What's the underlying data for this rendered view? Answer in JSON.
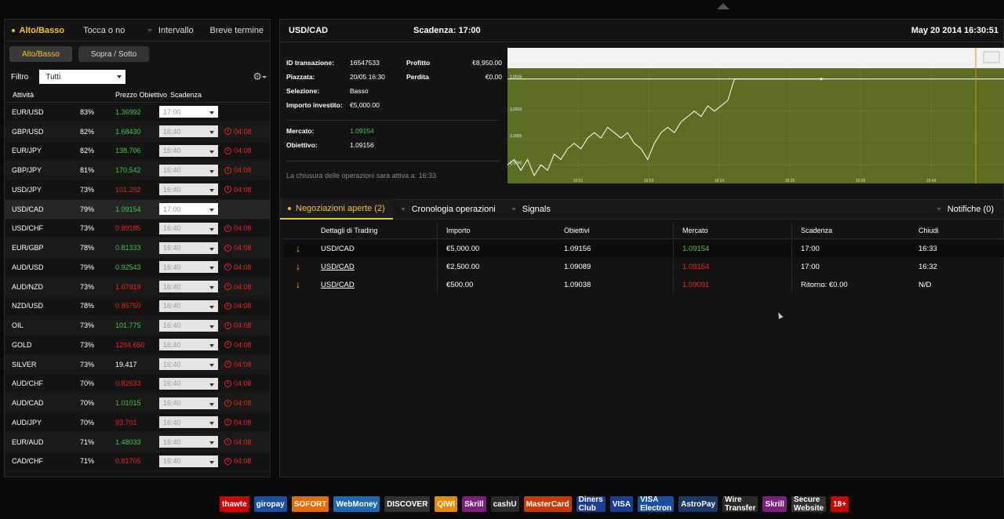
{
  "left": {
    "tabs": [
      "Alto/Basso",
      "Tocca o no",
      "Intervallo",
      "Breve termine"
    ],
    "subtabs": [
      "Alto/Basso",
      "Sopra / Sotto"
    ],
    "filter_label": "Filtro",
    "filter_value": "Tutti",
    "columns": [
      "Attività",
      "Prezzo Obiettivo",
      "Scadenza"
    ],
    "assets": [
      {
        "name": "EUR/USD",
        "pct": "83%",
        "price": "1.36992",
        "dir": "up",
        "exp": "17:00",
        "timer": ""
      },
      {
        "name": "GBP/USD",
        "pct": "82%",
        "price": "1.68430",
        "dir": "up",
        "exp": "16:40",
        "timer": "04:08"
      },
      {
        "name": "EUR/JPY",
        "pct": "82%",
        "price": "138.706",
        "dir": "up",
        "exp": "16:40",
        "timer": "04:08"
      },
      {
        "name": "GBP/JPY",
        "pct": "81%",
        "price": "170.542",
        "dir": "up",
        "exp": "16:40",
        "timer": "04:08"
      },
      {
        "name": "USD/JPY",
        "pct": "73%",
        "price": "101.252",
        "dir": "down",
        "exp": "16:40",
        "timer": "04:08"
      },
      {
        "name": "USD/CAD",
        "pct": "79%",
        "price": "1.09154",
        "dir": "up",
        "exp": "17:00",
        "timer": ""
      },
      {
        "name": "USD/CHF",
        "pct": "73%",
        "price": "0.89185",
        "dir": "down",
        "exp": "16:40",
        "timer": "04:08"
      },
      {
        "name": "EUR/GBP",
        "pct": "78%",
        "price": "0.81333",
        "dir": "up",
        "exp": "16:40",
        "timer": "04:08"
      },
      {
        "name": "AUD/USD",
        "pct": "79%",
        "price": "0.92543",
        "dir": "up",
        "exp": "16:40",
        "timer": "04:08"
      },
      {
        "name": "AUD/NZD",
        "pct": "73%",
        "price": "1.07919",
        "dir": "down",
        "exp": "16:40",
        "timer": "04:08"
      },
      {
        "name": "NZD/USD",
        "pct": "78%",
        "price": "0.85750",
        "dir": "down",
        "exp": "16:40",
        "timer": "04:08"
      },
      {
        "name": "OIL",
        "pct": "73%",
        "price": "101.775",
        "dir": "up",
        "exp": "16:40",
        "timer": "04:08"
      },
      {
        "name": "GOLD",
        "pct": "73%",
        "price": "1294.650",
        "dir": "down",
        "exp": "16:40",
        "timer": "04:08"
      },
      {
        "name": "SILVER",
        "pct": "73%",
        "price": "19.417",
        "dir": "neutral",
        "exp": "16:40",
        "timer": "04:08"
      },
      {
        "name": "AUD/CHF",
        "pct": "70%",
        "price": "0.82533",
        "dir": "down",
        "exp": "16:40",
        "timer": "04:08"
      },
      {
        "name": "AUD/CAD",
        "pct": "70%",
        "price": "1.01015",
        "dir": "up",
        "exp": "16:40",
        "timer": "04:08"
      },
      {
        "name": "AUD/JPY",
        "pct": "70%",
        "price": "93.701",
        "dir": "down",
        "exp": "16:40",
        "timer": "04:08"
      },
      {
        "name": "EUR/AUD",
        "pct": "71%",
        "price": "1.48033",
        "dir": "up",
        "exp": "16:40",
        "timer": "04:08"
      },
      {
        "name": "CAD/CHF",
        "pct": "71%",
        "price": "0.81705",
        "dir": "down",
        "exp": "16:40",
        "timer": "04:08"
      }
    ]
  },
  "right": {
    "pair": "USD/CAD",
    "expiry_label": "Scadenza:",
    "expiry_value": "17:00",
    "datetime": "May 20 2014  16:30:51",
    "info": {
      "id_label": "ID transazione:",
      "id_value": "16547533",
      "profit_label": "Profitto",
      "profit_value": "€8,950.00",
      "placed_label": "Piazzata:",
      "placed_value": "20/05 16:30",
      "loss_label": "Perdita",
      "loss_value": "€0.00",
      "selection_label": "Selezione:",
      "selection_value": "Basso",
      "invested_label": "Importo investito:",
      "invested_value": "€5,000.00",
      "market_label": "Mercato:",
      "market_value": "1.09154",
      "target_label": "Obiettivo:",
      "target_value": "1.09156",
      "close_note": "La chiusura delle operazioni sara attiva a: 16:33"
    },
    "order_tabs": [
      "Negoziazioni aperte (2)",
      "Cronologia operazioni",
      "Signals",
      "Notifiche (0)"
    ],
    "columns": [
      "Dettagli di Trading",
      "Importo",
      "Obiettivi",
      "Mercato",
      "Scadenza",
      "Chiudi"
    ],
    "trades": [
      {
        "pair": "USD/CAD",
        "amount": "€5,000.00",
        "target": "1.09156",
        "market": "1.09154",
        "mdir": "up",
        "expiry": "17:00",
        "close": "16:33"
      },
      {
        "pair": "USD/CAD",
        "amount": "€2,500.00",
        "target": "1.09089",
        "market": "1.09154",
        "mdir": "down",
        "expiry": "17:00",
        "close": "16:32"
      },
      {
        "pair": "USD/CAD",
        "amount": "€500.00",
        "target": "1.09038",
        "market": "1.09091",
        "mdir": "down",
        "expiry": "Ritorno: €0.00",
        "close": "N/D"
      }
    ]
  },
  "chart_data": {
    "type": "line",
    "y_ticks": [
      "1.0916",
      "1.0910",
      "1.0905",
      "1.0900"
    ],
    "x_ticks": [
      "15:51",
      "16:02",
      "16:14",
      "16:25",
      "16:36",
      "16:48"
    ],
    "ylim": [
      1.0898,
      1.0918
    ],
    "target_level": 1.0916,
    "values": [
      1.09,
      1.0901,
      1.0899,
      1.0901,
      1.0898,
      1.09,
      1.0899,
      1.0902,
      1.0901,
      1.0903,
      1.0904,
      1.0903,
      1.0905,
      1.0906,
      1.0905,
      1.0907,
      1.0906,
      1.0905,
      1.0906,
      1.0904,
      1.0903,
      1.0901,
      1.0904,
      1.0906,
      1.0907,
      1.0906,
      1.0908,
      1.0909,
      1.091,
      1.0909,
      1.0911,
      1.091,
      1.0911,
      1.0912,
      1.0916,
      1.0916,
      1.0916,
      1.0916,
      1.0916,
      1.0916,
      1.0916,
      1.0916,
      1.0916,
      1.0916,
      1.0916,
      1.0916,
      1.0916,
      1.0916
    ],
    "colors": {
      "fill": "#5b6e23",
      "line": "#ffffff",
      "grid": "#7f8f45"
    }
  },
  "footer": {
    "logos": [
      "thawte",
      "giropay",
      "SOFORT",
      "WebMoney",
      "DISCOVER",
      "QIWI",
      "Skrill",
      "cashU",
      "MasterCard",
      "Diners Club",
      "VISA",
      "VISA Electron",
      "AstroPay",
      "Wire Transfer",
      "Skrill",
      "Secure Website",
      "18+"
    ]
  }
}
